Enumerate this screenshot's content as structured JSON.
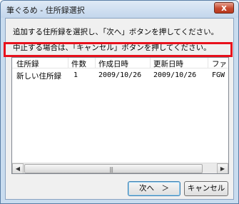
{
  "window": {
    "title": "筆ぐるめ - 住所録選択",
    "close_label": "x"
  },
  "messages": {
    "line1": "追加する住所録を選択し、「次へ」ボタンを押してください。",
    "line2": "中止する場合は、「キャンセル」ボタンを押してください。"
  },
  "list": {
    "columns": [
      "住所録",
      "件数",
      "作成日時",
      "更新日時",
      "ファ"
    ],
    "rows": [
      {
        "name": "新しい住所録",
        "count": "1",
        "created": "2009/10/26",
        "updated": "2009/10/26",
        "file": "FGW"
      }
    ]
  },
  "buttons": {
    "next": "次へ　＞",
    "cancel": "キャンセル"
  },
  "colors": {
    "highlight": "#e8101c",
    "title_bar": "#c9dcef"
  }
}
